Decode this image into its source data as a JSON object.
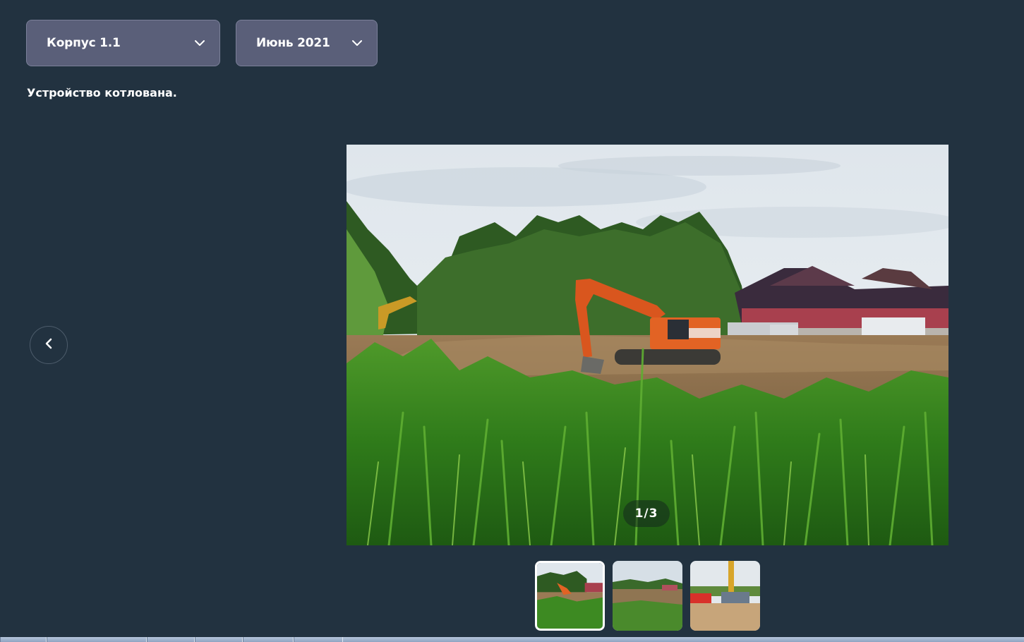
{
  "filters": {
    "building": {
      "selected": "Корпус 1.1"
    },
    "month": {
      "selected": "Июнь 2021"
    }
  },
  "description": "Устройство котлована.",
  "gallery": {
    "counter": "1/3",
    "current": 1,
    "total": 3
  },
  "icons": {
    "dropdown": "chevron-down-icon",
    "prev": "chevron-left-icon"
  },
  "colors": {
    "background": "#223240",
    "select_bg": "#5a5f79",
    "text": "#ffffff"
  }
}
